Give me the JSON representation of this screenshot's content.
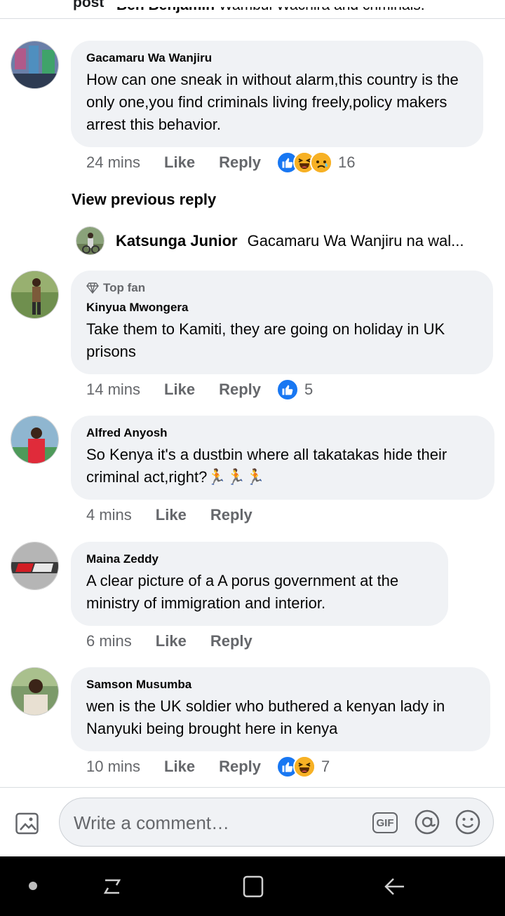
{
  "top": {
    "label": "post",
    "clipped_name": "Ben Benjamin",
    "clipped_text": "Wambui Wachira and criminals."
  },
  "comments": [
    {
      "author": "Gacamaru Wa Wanjiru",
      "text": "How can one sneak in without alarm,this country is the only one,you find criminals living freely,policy makers arrest this behavior.",
      "time": "24 mins",
      "like_label": "Like",
      "reply_label": "Reply",
      "reaction_count": "16",
      "reactions": [
        "like-icon",
        "haha-icon",
        "sad-icon"
      ]
    },
    {
      "badge": "Top fan",
      "author": "Kinyua Mwongera",
      "text": "Take them to Kamiti, they are going on holiday in UK prisons",
      "time": "14 mins",
      "like_label": "Like",
      "reply_label": "Reply",
      "reaction_count": "5",
      "reactions": [
        "like-icon"
      ]
    },
    {
      "author": "Alfred Anyosh",
      "text": "So Kenya it's a dustbin where all takatakas hide their criminal act,right?🏃🏃🏃",
      "time": "4 mins",
      "like_label": "Like",
      "reply_label": "Reply"
    },
    {
      "author": "Maina Zeddy",
      "text": "A clear picture of a A porus government at the ministry of immigration and interior.",
      "time": "6 mins",
      "like_label": "Like",
      "reply_label": "Reply"
    },
    {
      "author": "Samson Musumba",
      "text": "wen is the UK soldier who buthered a kenyan lady in Nanyuki being brought here in kenya",
      "time": "10 mins",
      "like_label": "Like",
      "reply_label": "Reply",
      "reaction_count": "7",
      "reactions": [
        "like-icon",
        "haha-icon"
      ]
    }
  ],
  "view_previous": "View previous reply",
  "reply_preview": {
    "author": "Katsunga Junior",
    "text": "Gacamaru Wa Wanjiru na wal..."
  },
  "composer": {
    "placeholder": "Write a comment…",
    "gif_label": "GIF"
  },
  "colors": {
    "bubble": "#f0f2f5",
    "meta_gray": "#65676b",
    "like_blue": "#1877f2",
    "emoji_yellow": "#f7b125"
  }
}
